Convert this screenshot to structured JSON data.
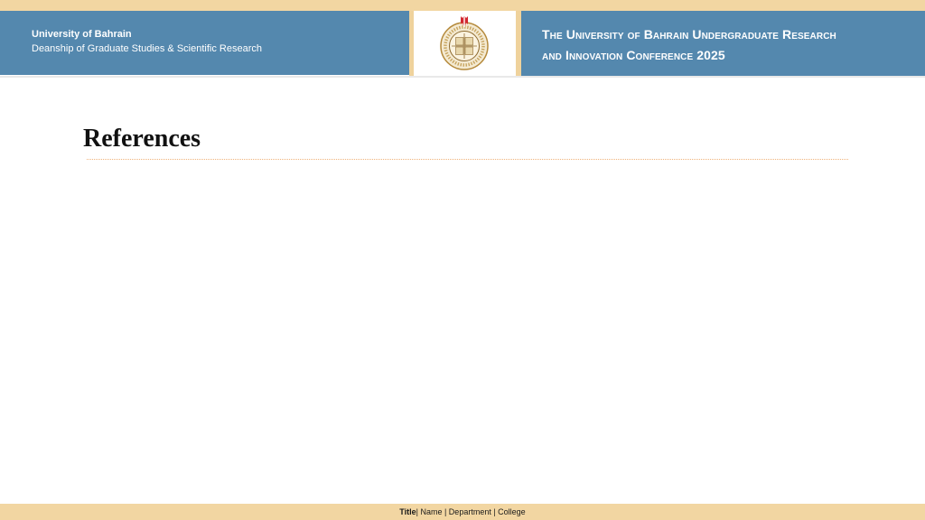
{
  "header": {
    "university": "University of Bahrain",
    "deanship": "Deanship of Graduate Studies & Scientific Research",
    "conference_line1": "The University of Bahrain Undergraduate Research",
    "conference_line2": "and Innovation Conference 2025"
  },
  "logo": {
    "icon": "university-seal"
  },
  "slide": {
    "title": "References"
  },
  "footer": {
    "title": "Title",
    "rest": "| Name | Department | College"
  },
  "colors": {
    "header_blue": "#5488ae",
    "accent_gold": "#f2d6a2",
    "rule": "#f0b37a"
  }
}
